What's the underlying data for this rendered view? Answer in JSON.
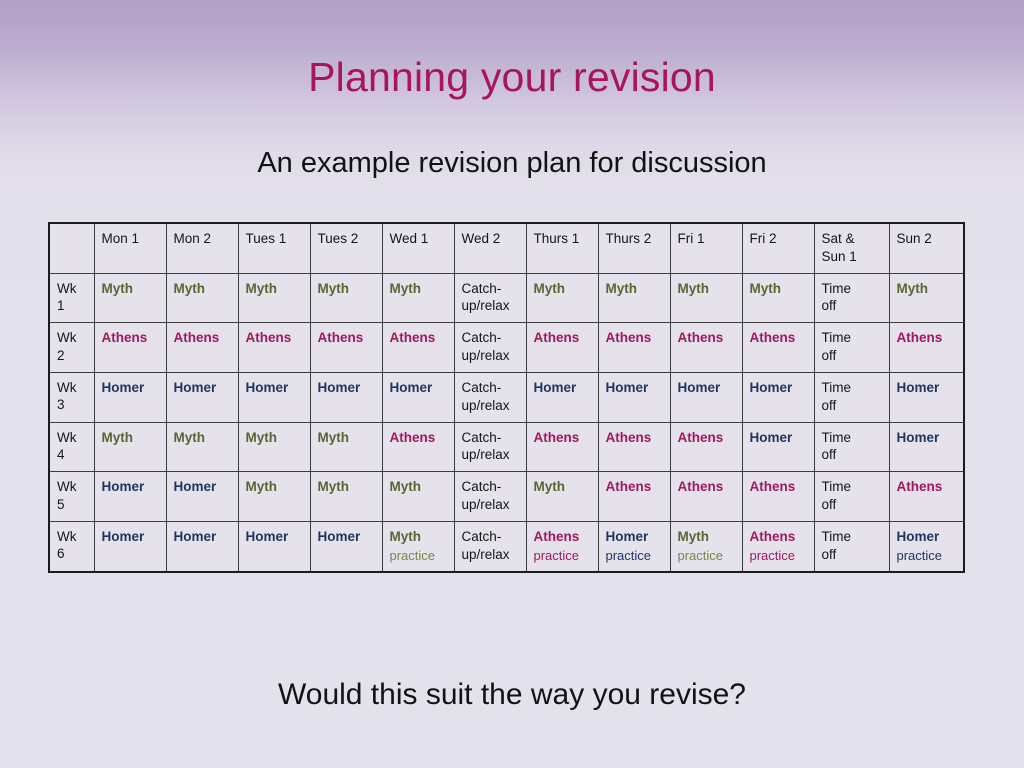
{
  "slide": {
    "title": "Planning your revision",
    "subtitle": "An example revision plan for discussion",
    "footer_question": "Would this suit the way you revise?"
  },
  "colors": {
    "title": "#a8155f",
    "myth": "#5d6433",
    "athens": "#a3175f",
    "homer": "#1f3663",
    "plain": "#151515",
    "background_top": "#b2a0c8",
    "background_bottom": "#e3e1eb",
    "table_cell": "#e5e2eb",
    "table_border": "#1b1b1b"
  },
  "table": {
    "corner_header": "",
    "columns": [
      "Mon 1",
      "Mon 2",
      "Tues 1",
      "Tues 2",
      "Wed 1",
      "Wed 2",
      "Thurs 1",
      "Thurs 2",
      "Fri  1",
      "Fri 2",
      "Sat &\nSun 1",
      "Sun 2"
    ],
    "rows": [
      {
        "week": "Wk\n1",
        "cells": [
          {
            "main": "Myth",
            "sub": "",
            "style": "myth"
          },
          {
            "main": "Myth",
            "sub": "",
            "style": "myth"
          },
          {
            "main": "Myth",
            "sub": "",
            "style": "myth"
          },
          {
            "main": "Myth",
            "sub": "",
            "style": "myth"
          },
          {
            "main": "Myth",
            "sub": "",
            "style": "myth"
          },
          {
            "main": "Catch-\nup/relax",
            "sub": "",
            "style": "plain"
          },
          {
            "main": "Myth",
            "sub": "",
            "style": "myth"
          },
          {
            "main": "Myth",
            "sub": "",
            "style": "myth"
          },
          {
            "main": "Myth",
            "sub": "",
            "style": "myth"
          },
          {
            "main": "Myth",
            "sub": "",
            "style": "myth"
          },
          {
            "main": "Time\noff",
            "sub": "",
            "style": "plain"
          },
          {
            "main": "Myth",
            "sub": "",
            "style": "myth"
          }
        ]
      },
      {
        "week": "Wk\n2",
        "cells": [
          {
            "main": "Athens",
            "sub": "",
            "style": "athens"
          },
          {
            "main": "Athens",
            "sub": "",
            "style": "athens"
          },
          {
            "main": "Athens",
            "sub": "",
            "style": "athens"
          },
          {
            "main": "Athens",
            "sub": "",
            "style": "athens"
          },
          {
            "main": "Athens",
            "sub": "",
            "style": "athens"
          },
          {
            "main": "Catch-\nup/relax",
            "sub": "",
            "style": "plain"
          },
          {
            "main": "Athens",
            "sub": "",
            "style": "athens"
          },
          {
            "main": "Athens",
            "sub": "",
            "style": "athens"
          },
          {
            "main": "Athens",
            "sub": "",
            "style": "athens"
          },
          {
            "main": "Athens",
            "sub": "",
            "style": "athens"
          },
          {
            "main": "Time\noff",
            "sub": "",
            "style": "plain"
          },
          {
            "main": "Athens",
            "sub": "",
            "style": "athens"
          }
        ]
      },
      {
        "week": "Wk\n3",
        "cells": [
          {
            "main": "Homer",
            "sub": "",
            "style": "homer"
          },
          {
            "main": "Homer",
            "sub": "",
            "style": "homer"
          },
          {
            "main": "Homer",
            "sub": "",
            "style": "homer"
          },
          {
            "main": "Homer",
            "sub": "",
            "style": "homer"
          },
          {
            "main": "Homer",
            "sub": "",
            "style": "homer"
          },
          {
            "main": "Catch-\nup/relax",
            "sub": "",
            "style": "plain"
          },
          {
            "main": "Homer",
            "sub": "",
            "style": "homer"
          },
          {
            "main": "Homer",
            "sub": "",
            "style": "homer"
          },
          {
            "main": "Homer",
            "sub": "",
            "style": "homer"
          },
          {
            "main": "Homer",
            "sub": "",
            "style": "homer"
          },
          {
            "main": "Time\noff",
            "sub": "",
            "style": "plain"
          },
          {
            "main": "Homer",
            "sub": "",
            "style": "homer"
          }
        ]
      },
      {
        "week": "Wk\n4",
        "cells": [
          {
            "main": "Myth",
            "sub": "",
            "style": "myth"
          },
          {
            "main": "Myth",
            "sub": "",
            "style": "myth"
          },
          {
            "main": "Myth",
            "sub": "",
            "style": "myth"
          },
          {
            "main": "Myth",
            "sub": "",
            "style": "myth"
          },
          {
            "main": "Athens",
            "sub": "",
            "style": "athens"
          },
          {
            "main": "Catch-\nup/relax",
            "sub": "",
            "style": "plain"
          },
          {
            "main": "Athens",
            "sub": "",
            "style": "athens"
          },
          {
            "main": "Athens",
            "sub": "",
            "style": "athens"
          },
          {
            "main": "Athens",
            "sub": "",
            "style": "athens"
          },
          {
            "main": "Homer",
            "sub": "",
            "style": "homer"
          },
          {
            "main": "Time\noff",
            "sub": "",
            "style": "plain"
          },
          {
            "main": "Homer",
            "sub": "",
            "style": "homer"
          }
        ]
      },
      {
        "week": "Wk\n5",
        "cells": [
          {
            "main": "Homer",
            "sub": "",
            "style": "homer"
          },
          {
            "main": "Homer",
            "sub": "",
            "style": "homer"
          },
          {
            "main": "Myth",
            "sub": "",
            "style": "myth"
          },
          {
            "main": "Myth",
            "sub": "",
            "style": "myth"
          },
          {
            "main": "Myth",
            "sub": "",
            "style": "myth"
          },
          {
            "main": "Catch-\nup/relax",
            "sub": "",
            "style": "plain"
          },
          {
            "main": "Myth",
            "sub": "",
            "style": "myth"
          },
          {
            "main": "Athens",
            "sub": "",
            "style": "athens"
          },
          {
            "main": "Athens",
            "sub": "",
            "style": "athens"
          },
          {
            "main": "Athens",
            "sub": "",
            "style": "athens"
          },
          {
            "main": "Time\noff",
            "sub": "",
            "style": "plain"
          },
          {
            "main": "Athens",
            "sub": "",
            "style": "athens"
          }
        ]
      },
      {
        "week": "Wk\n6",
        "cells": [
          {
            "main": "Homer",
            "sub": "",
            "style": "homer"
          },
          {
            "main": "Homer",
            "sub": "",
            "style": "homer"
          },
          {
            "main": "Homer",
            "sub": "",
            "style": "homer"
          },
          {
            "main": "Homer",
            "sub": "",
            "style": "homer"
          },
          {
            "main": "Myth",
            "sub": "practice",
            "style": "myth"
          },
          {
            "main": "Catch-\nup/relax",
            "sub": "",
            "style": "plain"
          },
          {
            "main": "Athens",
            "sub": "practice",
            "style": "athens"
          },
          {
            "main": "Homer",
            "sub": "practice",
            "style": "homer"
          },
          {
            "main": "Myth",
            "sub": "practice",
            "style": "myth"
          },
          {
            "main": "Athens",
            "sub": "practice",
            "style": "athens"
          },
          {
            "main": "Time\noff",
            "sub": "",
            "style": "plain"
          },
          {
            "main": "Homer",
            "sub": "practice",
            "style": "homer"
          }
        ]
      }
    ]
  }
}
